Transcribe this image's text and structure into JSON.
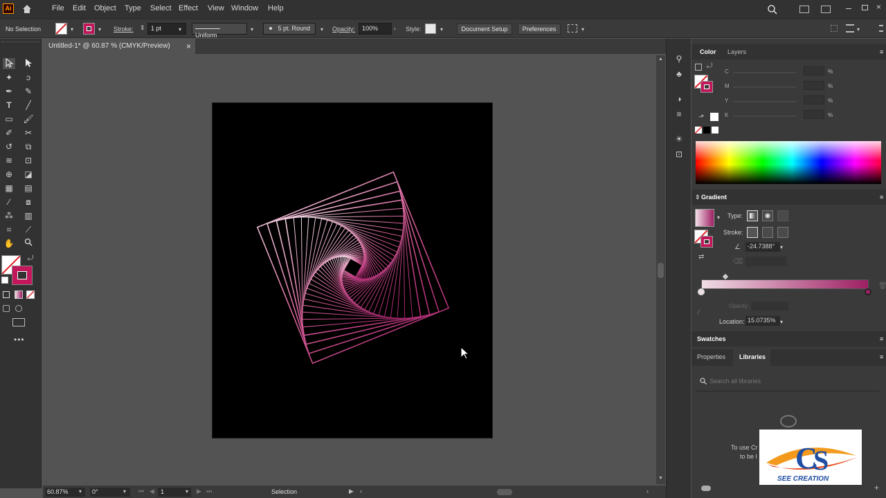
{
  "app": {
    "logo": "Ai"
  },
  "menu": [
    "File",
    "Edit",
    "Object",
    "Type",
    "Select",
    "Effect",
    "View",
    "Window",
    "Help"
  ],
  "control": {
    "selection_state": "No Selection",
    "stroke_label": "Stroke:",
    "stroke_weight": "1 pt",
    "profile": "Uniform",
    "brush": "5 pt. Round",
    "opacity_label": "Opacity:",
    "opacity_value": "100%",
    "style_label": "Style:",
    "doc_setup": "Document Setup",
    "preferences": "Preferences"
  },
  "document": {
    "tab_title": "Untitled-1* @ 60.87 % (CMYK/Preview)",
    "close": "×"
  },
  "colors": {
    "accent": "#c2185b",
    "gradient_start": "#f1dde6",
    "gradient_end": "#9e1f63",
    "artboard": "#000000"
  },
  "status": {
    "zoom": "60.87%",
    "rotate": "0°",
    "page": "1",
    "tool": "Selection"
  },
  "color_panel": {
    "tab_color": "Color",
    "tab_layers": "Layers",
    "channels": [
      "C",
      "M",
      "Y",
      "K"
    ],
    "unit": "%"
  },
  "gradient_panel": {
    "title": "Gradient",
    "type_label": "Type:",
    "stroke_label": "Stroke:",
    "angle": "-24.7388°",
    "opacity_label": "Opacity:",
    "location_label": "Location:",
    "location_value": "15.0735%"
  },
  "swatches": {
    "title": "Swatches"
  },
  "libraries": {
    "tab_properties": "Properties",
    "tab_libraries": "Libraries",
    "search_placeholder": "Search all libraries",
    "body_text_1": "To use Cr",
    "body_text_2": "to be l"
  },
  "watermark": {
    "text": "SEE CREATION"
  },
  "icons": [
    "home-icon",
    "search-icon",
    "selection-tool-icon",
    "direct-selection-icon",
    "pen-icon",
    "type-icon",
    "line-icon",
    "rectangle-icon",
    "paintbrush-icon",
    "rotate-icon",
    "hand-icon",
    "zoom-icon"
  ]
}
